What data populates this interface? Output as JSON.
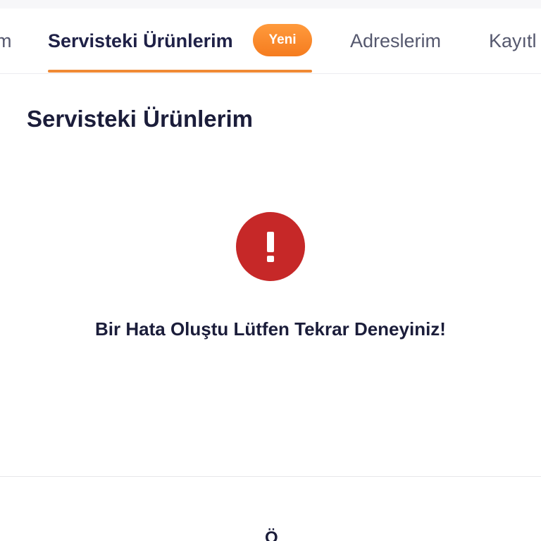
{
  "tabs": {
    "prev_partial": "m",
    "active": "Servisteki Ürünlerim",
    "active_badge": "Yeni",
    "addresses": "Adreslerim",
    "saved_partial": "Kayıtl"
  },
  "content": {
    "title": "Servisteki Ürünlerim",
    "error_message": "Bir Hata Oluştu Lütfen Tekrar Deneyiniz!"
  },
  "bottom": {
    "partial_text": "Ö"
  },
  "colors": {
    "accent": "#f08a35",
    "badge": "#f57c1f",
    "error": "#c62828",
    "text": "#1b1d3a"
  },
  "icons": {
    "error": "exclamation-circle-icon"
  }
}
